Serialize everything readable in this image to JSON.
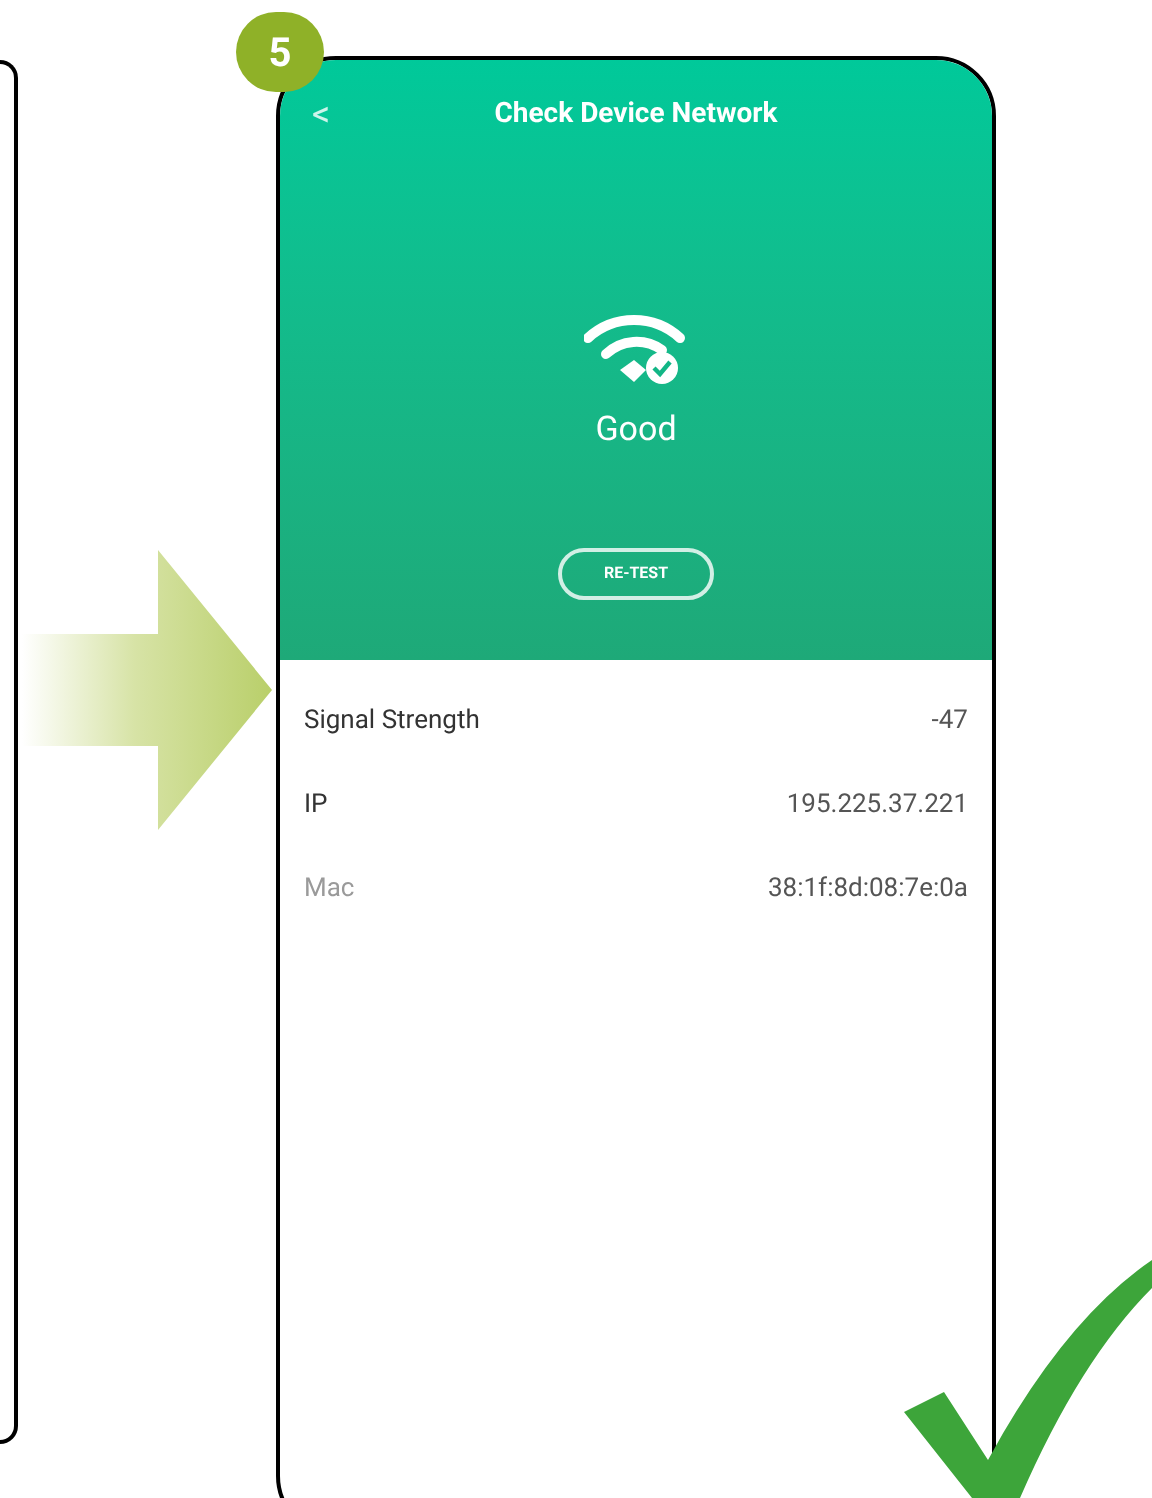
{
  "step_badge": "5",
  "header": {
    "back": "<",
    "title": "Check Device Network",
    "status": "Good",
    "button": "RE-TEST"
  },
  "rows": [
    {
      "label": "Signal Strength",
      "value": "-47",
      "dimmed": false
    },
    {
      "label": "IP",
      "value": "195.225.37.221",
      "dimmed": false
    },
    {
      "label": "Mac",
      "value": "38:1f:8d:08:7e:0a",
      "dimmed": true
    }
  ]
}
